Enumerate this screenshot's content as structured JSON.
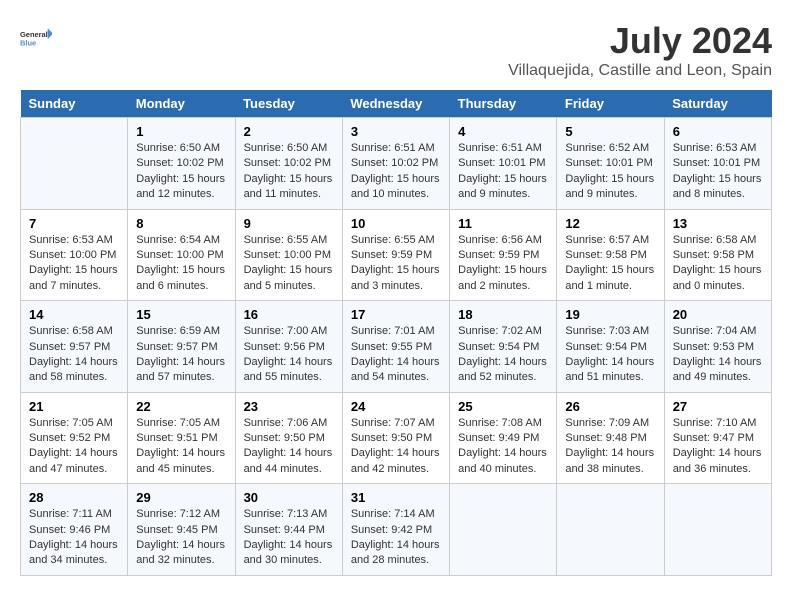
{
  "logo": {
    "line1": "General",
    "line2": "Blue"
  },
  "title": "July 2024",
  "subtitle": "Villaquejida, Castille and Leon, Spain",
  "weekdays": [
    "Sunday",
    "Monday",
    "Tuesday",
    "Wednesday",
    "Thursday",
    "Friday",
    "Saturday"
  ],
  "weeks": [
    [
      {
        "day": "",
        "info": ""
      },
      {
        "day": "1",
        "info": "Sunrise: 6:50 AM\nSunset: 10:02 PM\nDaylight: 15 hours\nand 12 minutes."
      },
      {
        "day": "2",
        "info": "Sunrise: 6:50 AM\nSunset: 10:02 PM\nDaylight: 15 hours\nand 11 minutes."
      },
      {
        "day": "3",
        "info": "Sunrise: 6:51 AM\nSunset: 10:02 PM\nDaylight: 15 hours\nand 10 minutes."
      },
      {
        "day": "4",
        "info": "Sunrise: 6:51 AM\nSunset: 10:01 PM\nDaylight: 15 hours\nand 9 minutes."
      },
      {
        "day": "5",
        "info": "Sunrise: 6:52 AM\nSunset: 10:01 PM\nDaylight: 15 hours\nand 9 minutes."
      },
      {
        "day": "6",
        "info": "Sunrise: 6:53 AM\nSunset: 10:01 PM\nDaylight: 15 hours\nand 8 minutes."
      }
    ],
    [
      {
        "day": "7",
        "info": "Sunrise: 6:53 AM\nSunset: 10:00 PM\nDaylight: 15 hours\nand 7 minutes."
      },
      {
        "day": "8",
        "info": "Sunrise: 6:54 AM\nSunset: 10:00 PM\nDaylight: 15 hours\nand 6 minutes."
      },
      {
        "day": "9",
        "info": "Sunrise: 6:55 AM\nSunset: 10:00 PM\nDaylight: 15 hours\nand 5 minutes."
      },
      {
        "day": "10",
        "info": "Sunrise: 6:55 AM\nSunset: 9:59 PM\nDaylight: 15 hours\nand 3 minutes."
      },
      {
        "day": "11",
        "info": "Sunrise: 6:56 AM\nSunset: 9:59 PM\nDaylight: 15 hours\nand 2 minutes."
      },
      {
        "day": "12",
        "info": "Sunrise: 6:57 AM\nSunset: 9:58 PM\nDaylight: 15 hours\nand 1 minute."
      },
      {
        "day": "13",
        "info": "Sunrise: 6:58 AM\nSunset: 9:58 PM\nDaylight: 15 hours\nand 0 minutes."
      }
    ],
    [
      {
        "day": "14",
        "info": "Sunrise: 6:58 AM\nSunset: 9:57 PM\nDaylight: 14 hours\nand 58 minutes."
      },
      {
        "day": "15",
        "info": "Sunrise: 6:59 AM\nSunset: 9:57 PM\nDaylight: 14 hours\nand 57 minutes."
      },
      {
        "day": "16",
        "info": "Sunrise: 7:00 AM\nSunset: 9:56 PM\nDaylight: 14 hours\nand 55 minutes."
      },
      {
        "day": "17",
        "info": "Sunrise: 7:01 AM\nSunset: 9:55 PM\nDaylight: 14 hours\nand 54 minutes."
      },
      {
        "day": "18",
        "info": "Sunrise: 7:02 AM\nSunset: 9:54 PM\nDaylight: 14 hours\nand 52 minutes."
      },
      {
        "day": "19",
        "info": "Sunrise: 7:03 AM\nSunset: 9:54 PM\nDaylight: 14 hours\nand 51 minutes."
      },
      {
        "day": "20",
        "info": "Sunrise: 7:04 AM\nSunset: 9:53 PM\nDaylight: 14 hours\nand 49 minutes."
      }
    ],
    [
      {
        "day": "21",
        "info": "Sunrise: 7:05 AM\nSunset: 9:52 PM\nDaylight: 14 hours\nand 47 minutes."
      },
      {
        "day": "22",
        "info": "Sunrise: 7:05 AM\nSunset: 9:51 PM\nDaylight: 14 hours\nand 45 minutes."
      },
      {
        "day": "23",
        "info": "Sunrise: 7:06 AM\nSunset: 9:50 PM\nDaylight: 14 hours\nand 44 minutes."
      },
      {
        "day": "24",
        "info": "Sunrise: 7:07 AM\nSunset: 9:50 PM\nDaylight: 14 hours\nand 42 minutes."
      },
      {
        "day": "25",
        "info": "Sunrise: 7:08 AM\nSunset: 9:49 PM\nDaylight: 14 hours\nand 40 minutes."
      },
      {
        "day": "26",
        "info": "Sunrise: 7:09 AM\nSunset: 9:48 PM\nDaylight: 14 hours\nand 38 minutes."
      },
      {
        "day": "27",
        "info": "Sunrise: 7:10 AM\nSunset: 9:47 PM\nDaylight: 14 hours\nand 36 minutes."
      }
    ],
    [
      {
        "day": "28",
        "info": "Sunrise: 7:11 AM\nSunset: 9:46 PM\nDaylight: 14 hours\nand 34 minutes."
      },
      {
        "day": "29",
        "info": "Sunrise: 7:12 AM\nSunset: 9:45 PM\nDaylight: 14 hours\nand 32 minutes."
      },
      {
        "day": "30",
        "info": "Sunrise: 7:13 AM\nSunset: 9:44 PM\nDaylight: 14 hours\nand 30 minutes."
      },
      {
        "day": "31",
        "info": "Sunrise: 7:14 AM\nSunset: 9:42 PM\nDaylight: 14 hours\nand 28 minutes."
      },
      {
        "day": "",
        "info": ""
      },
      {
        "day": "",
        "info": ""
      },
      {
        "day": "",
        "info": ""
      }
    ]
  ]
}
